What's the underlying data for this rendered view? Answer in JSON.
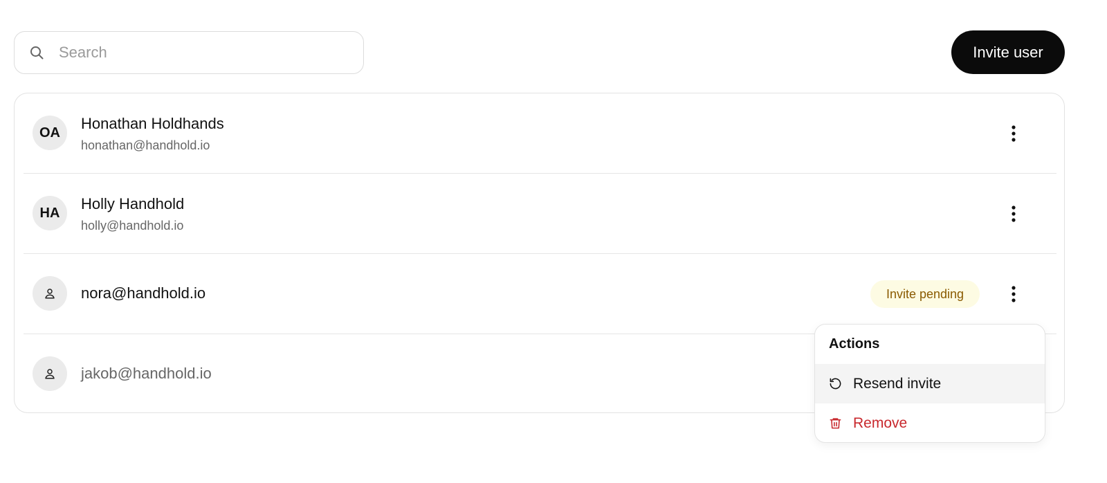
{
  "toolbar": {
    "search_placeholder": "Search",
    "search_value": "",
    "search_icon": "search-icon",
    "invite_label": "Invite user"
  },
  "users": [
    {
      "initials": "OA",
      "name": "Honathan Holdhands",
      "email": "honathan@handhold.io",
      "menu_icon": "more-vertical-icon"
    },
    {
      "initials": "HA",
      "name": "Holly Handhold",
      "email": "holly@handhold.io",
      "menu_icon": "more-vertical-icon"
    },
    {
      "avatar_icon": "user-icon",
      "email": "nora@handhold.io",
      "status": "Invite pending",
      "menu_icon": "more-vertical-icon"
    },
    {
      "avatar_icon": "user-icon",
      "email": "jakob@handhold.io"
    }
  ],
  "actions_menu": {
    "heading": "Actions",
    "items": [
      {
        "label": "Resend invite",
        "icon": "rotate-ccw-icon"
      },
      {
        "label": "Remove",
        "icon": "trash-icon"
      }
    ]
  },
  "colors": {
    "primary_button": "#0b0b0b",
    "badge_background": "#fdfbe3",
    "badge_text": "#8a5a00",
    "danger": "#c8282d",
    "muted_text": "#666666"
  }
}
